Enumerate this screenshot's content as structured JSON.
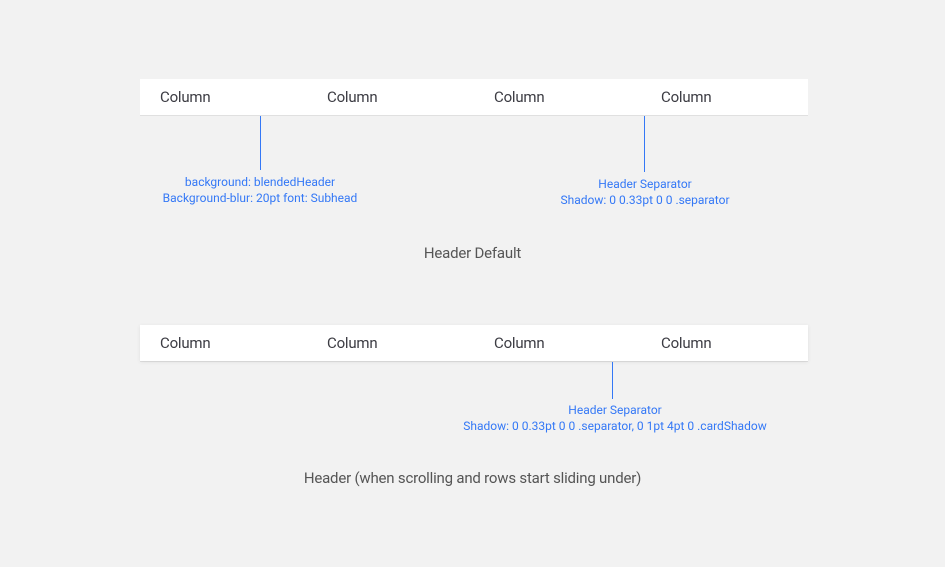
{
  "example1": {
    "columns": [
      "Column",
      "Column",
      "Column",
      "Column"
    ],
    "caption": "Header Default",
    "annotation_background": {
      "line1": "background: blendedHeader",
      "line2": "Background-blur: 20pt font: Subhead"
    },
    "annotation_separator": {
      "line1": "Header Separator",
      "line2": "Shadow: 0 0.33pt 0 0 .separator"
    }
  },
  "example2": {
    "columns": [
      "Column",
      "Column",
      "Column",
      "Column"
    ],
    "caption": "Header (when scrolling and rows start sliding under)",
    "annotation_separator": {
      "line1": "Header Separator",
      "line2": "Shadow: 0 0.33pt 0 0 .separator, 0 1pt 4pt 0 .cardShadow"
    }
  }
}
